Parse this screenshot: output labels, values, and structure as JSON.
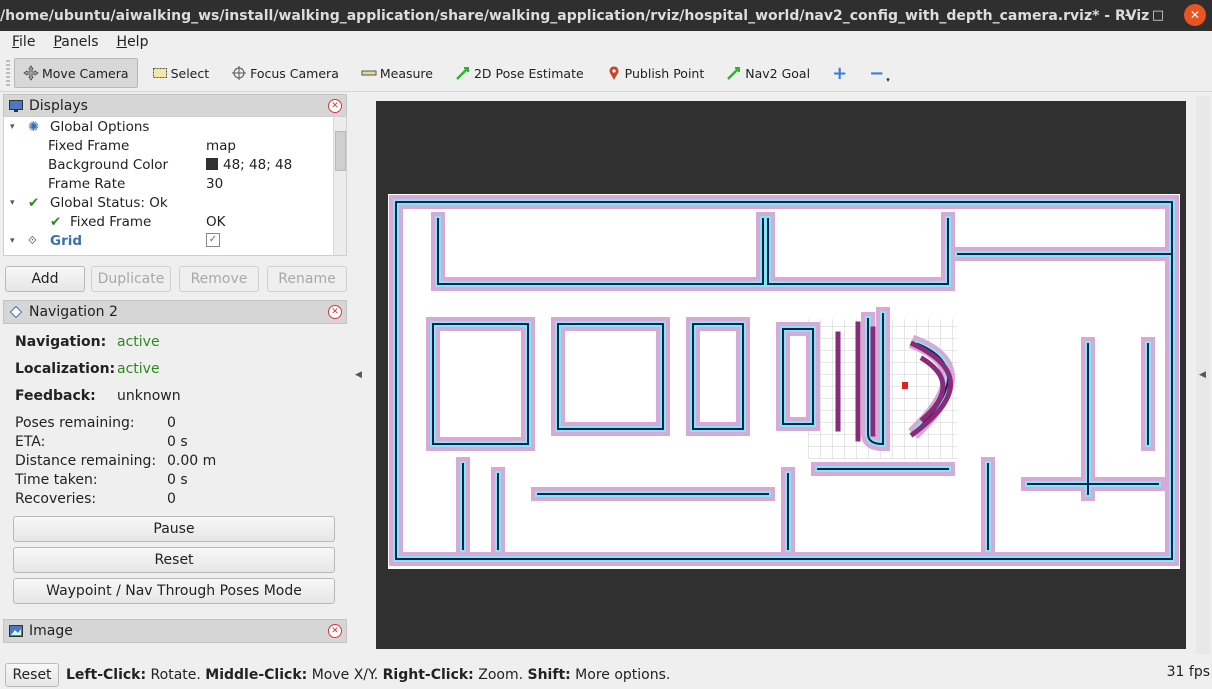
{
  "window": {
    "title": "/home/ubuntu/aiwalking_ws/install/walking_application/share/walking_application/rviz/hospital_world/nav2_config_with_depth_camera.rviz* - RViz",
    "minimize": "–",
    "maximize": "□",
    "close": "✕"
  },
  "menu": [
    "File",
    "Panels",
    "Help"
  ],
  "toolbar": {
    "tools": [
      {
        "label": "Move Camera",
        "icon": "move-camera-icon",
        "active": true
      },
      {
        "label": "Select",
        "icon": "select-icon"
      },
      {
        "label": "Focus Camera",
        "icon": "focus-camera-icon"
      },
      {
        "label": "Measure",
        "icon": "measure-icon"
      },
      {
        "label": "2D Pose Estimate",
        "icon": "arrow-green-icon"
      },
      {
        "label": "Publish Point",
        "icon": "map-pin-icon"
      },
      {
        "label": "Nav2 Goal",
        "icon": "arrow-green-icon"
      }
    ],
    "add_icon": "+",
    "remove_icon": "−"
  },
  "displays": {
    "title": "Displays",
    "rows": [
      {
        "name": "Global Options",
        "value": "",
        "indent": 0
      },
      {
        "name": "Fixed Frame",
        "value": "map",
        "indent": 1
      },
      {
        "name": "Background Color",
        "value": "48; 48; 48",
        "indent": 1
      },
      {
        "name": "Frame Rate",
        "value": "30",
        "indent": 1
      },
      {
        "name": "Global Status: Ok",
        "value": "",
        "indent": 0
      },
      {
        "name": "Fixed Frame",
        "value": "OK",
        "indent": 1
      },
      {
        "name": "Grid",
        "value": "",
        "indent": 0
      }
    ],
    "buttons": {
      "add": "Add",
      "duplicate": "Duplicate",
      "remove": "Remove",
      "rename": "Rename"
    },
    "background_color": "#303030"
  },
  "navigation": {
    "title": "Navigation 2",
    "navigation_label": "Navigation:",
    "navigation_value": "active",
    "localization_label": "Localization:",
    "localization_value": "active",
    "feedback_label": "Feedback:",
    "feedback_value": "unknown",
    "stats": [
      {
        "label": "Poses remaining:",
        "value": "0"
      },
      {
        "label": "ETA:",
        "value": "0 s"
      },
      {
        "label": "Distance remaining:",
        "value": "0.00 m"
      },
      {
        "label": "Time taken:",
        "value": "0 s"
      },
      {
        "label": "Recoveries:",
        "value": "0"
      }
    ],
    "pause": "Pause",
    "reset": "Reset",
    "waypoint": "Waypoint / Nav Through Poses Mode"
  },
  "image_panel": {
    "title": "Image"
  },
  "status": {
    "reset": "Reset",
    "hint_parts": [
      {
        "b": "Left-Click:",
        "t": " Rotate. "
      },
      {
        "b": "Middle-Click:",
        "t": " Move X/Y. "
      },
      {
        "b": "Right-Click:",
        "t": " Zoom. "
      },
      {
        "b": "Shift:",
        "t": " More options."
      }
    ],
    "fps": "31 fps"
  },
  "colors": {
    "accent_green": "#2a8a1a",
    "close_orange": "#e95420",
    "map_costmap": "#d8a9d6",
    "map_inflation": "#7fe9f0",
    "map_wall": "#1c1a55"
  }
}
